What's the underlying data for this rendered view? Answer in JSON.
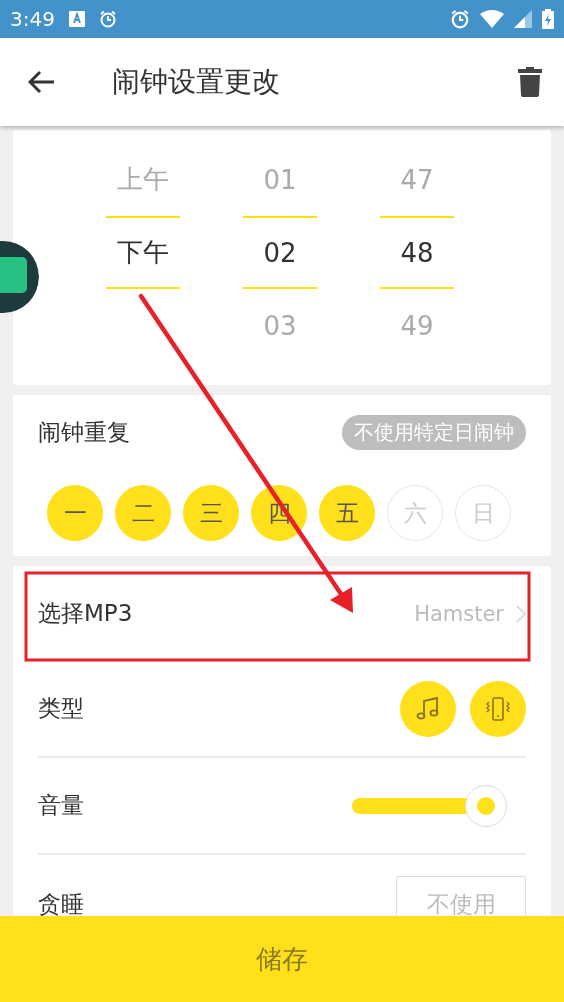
{
  "status_bar": {
    "time": "3:49"
  },
  "app_bar": {
    "title": "闹钟设置更改"
  },
  "time_picker": {
    "columns": [
      {
        "items": [
          {
            "text": "上午",
            "selected": false
          },
          {
            "text": "下午",
            "selected": true
          }
        ]
      },
      {
        "items": [
          {
            "text": "01",
            "selected": false
          },
          {
            "text": "02",
            "selected": true
          },
          {
            "text": "03",
            "selected": false
          }
        ]
      },
      {
        "items": [
          {
            "text": "47",
            "selected": false
          },
          {
            "text": "48",
            "selected": true
          },
          {
            "text": "49",
            "selected": false
          }
        ]
      }
    ]
  },
  "repeat": {
    "label": "闹钟重复",
    "toggle": "不使用特定日闹钟",
    "days": [
      {
        "label": "一",
        "selected": true
      },
      {
        "label": "二",
        "selected": true
      },
      {
        "label": "三",
        "selected": true
      },
      {
        "label": "四",
        "selected": true
      },
      {
        "label": "五",
        "selected": true
      },
      {
        "label": "六",
        "selected": false
      },
      {
        "label": "日",
        "selected": false
      }
    ]
  },
  "settings": [
    {
      "kind": "link",
      "label": "选择MP3",
      "value": "Hamster"
    },
    {
      "kind": "type",
      "label": "类型",
      "options": [
        {
          "kind": "music",
          "selected": true
        },
        {
          "kind": "vibrate",
          "selected": true
        }
      ]
    },
    {
      "kind": "slider",
      "label": "音量",
      "level": 0.88
    },
    {
      "kind": "field",
      "label": "贪睡",
      "value": "不使用"
    }
  ],
  "save_button": "储存"
}
